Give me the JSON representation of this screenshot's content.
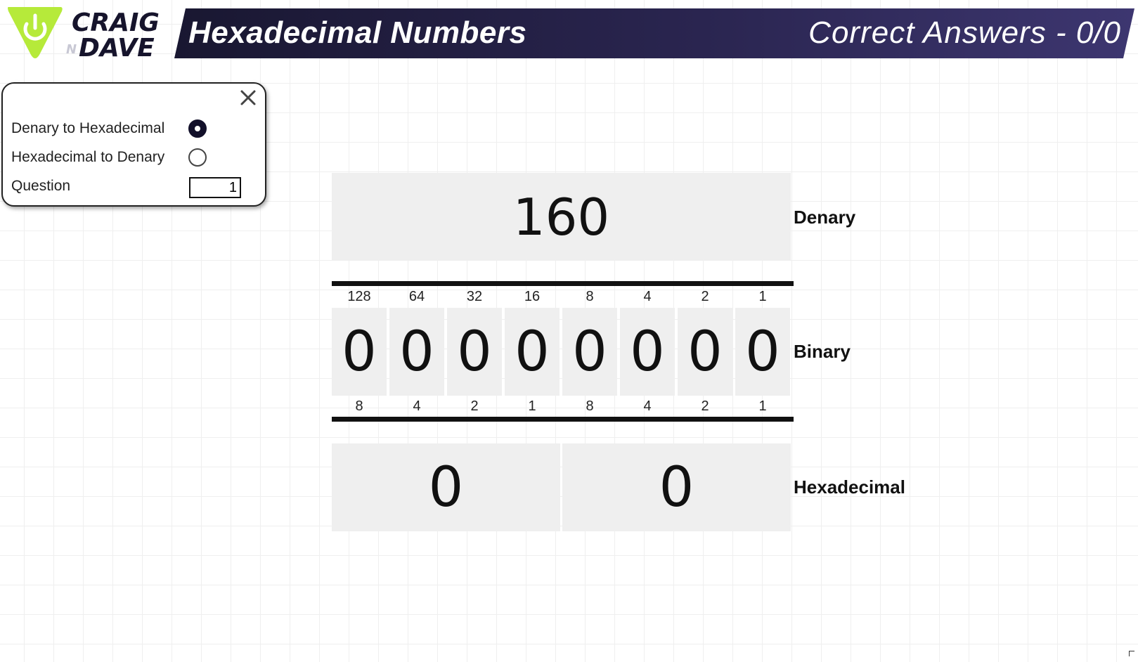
{
  "header": {
    "logo_line1": "CRAIG",
    "logo_n": "N",
    "logo_line2": "DAVE",
    "title": "Hexadecimal Numbers",
    "score_label": "Correct Answers - 0/0"
  },
  "panel": {
    "option_denary_to_hex": "Denary to Hexadecimal",
    "option_hex_to_denary": "Hexadecimal to Denary",
    "question_label": "Question",
    "question_value": "1",
    "selected_mode": "denary-to-hexadecimal"
  },
  "denary": {
    "value": "160",
    "label": "Denary"
  },
  "binary": {
    "label": "Binary",
    "weights_top": [
      "128",
      "64",
      "32",
      "16",
      "8",
      "4",
      "2",
      "1"
    ],
    "weights_bottom": [
      "8",
      "4",
      "2",
      "1",
      "8",
      "4",
      "2",
      "1"
    ],
    "bits": [
      "0",
      "0",
      "0",
      "0",
      "0",
      "0",
      "0",
      "0"
    ]
  },
  "hexadecimal": {
    "label": "Hexadecimal",
    "digits": [
      "0",
      "0"
    ]
  },
  "colors": {
    "header_dark": "#191731",
    "header_light": "#3d3670",
    "logo_green": "#b6ea3a",
    "box_grey": "#efefef"
  },
  "icons": {
    "logo": "power-icon",
    "close": "close-icon"
  }
}
